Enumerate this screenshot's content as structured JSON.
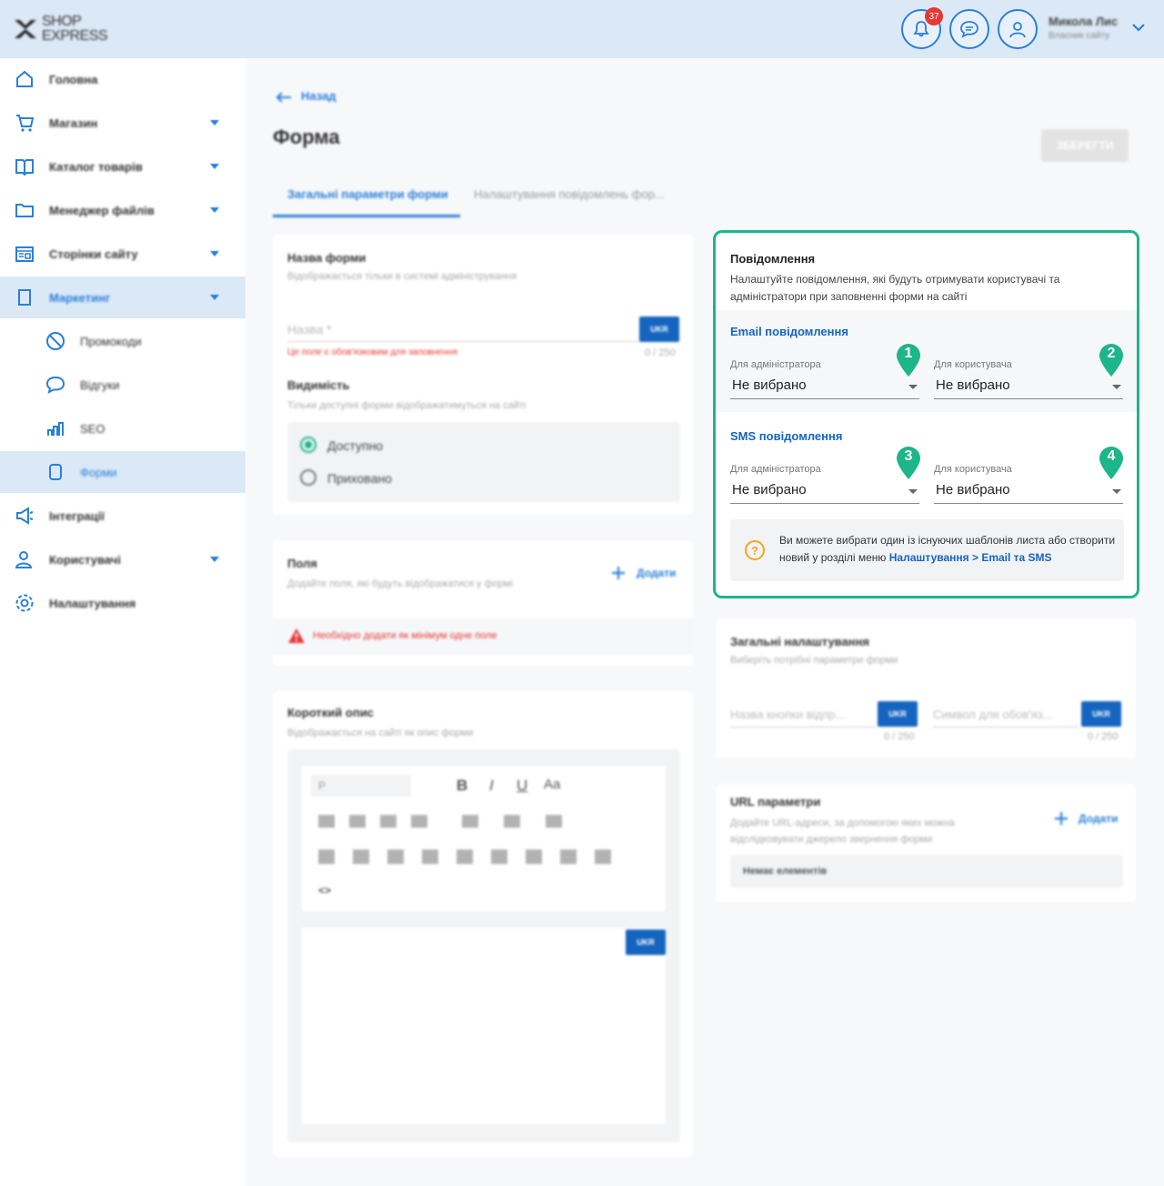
{
  "header": {
    "logo_line1": "SHOP",
    "logo_line2": "EXPRESS",
    "notifications_count": "37",
    "user_name": "Микола Лис",
    "user_role": "Власник сайту"
  },
  "sidebar": {
    "items": [
      {
        "label": "Головна",
        "icon": "home-icon"
      },
      {
        "label": "Магазин",
        "icon": "cart-icon"
      },
      {
        "label": "Каталог товарів",
        "icon": "catalog-icon"
      },
      {
        "label": "Менеджер файлів",
        "icon": "folder-icon"
      },
      {
        "label": "Сторінки сайту",
        "icon": "pages-icon"
      },
      {
        "label": "Маркетинг",
        "icon": "marketing-icon"
      },
      {
        "label": "Промокоди",
        "icon": "promo-icon"
      },
      {
        "label": "Відгуки",
        "icon": "reviews-icon"
      },
      {
        "label": "SEO",
        "icon": "seo-icon"
      },
      {
        "label": "Форми",
        "icon": "forms-icon"
      },
      {
        "label": "Інтеграції",
        "icon": "megaphone-icon"
      },
      {
        "label": "Користувачі",
        "icon": "users-icon"
      },
      {
        "label": "Налаштування",
        "icon": "settings-icon"
      }
    ]
  },
  "page": {
    "back": "Назад",
    "title": "Форма",
    "save": "ЗБЕРЕГТИ",
    "tabs": [
      "Загальні параметри форми",
      "Налаштування повідомлень фор..."
    ]
  },
  "name_card": {
    "title": "Назва форми",
    "sub": "Відображається тільки в системі адміністрування",
    "placeholder": "Назва *",
    "lang": "UKR",
    "error": "Це поле є обов'язковим для заповнення",
    "counter": "0 / 250",
    "visibility_title": "Видимість",
    "visibility_sub": "Тільки доступні форми відображатимуться на сайті",
    "opt_available": "Доступно",
    "opt_hidden": "Приховано"
  },
  "fields_card": {
    "title": "Поля",
    "sub": "Додайте поля, які будуть відображатися у формі",
    "add": "Додати",
    "warning": "Необхідно додати як мінімум одне поле"
  },
  "desc_card": {
    "title": "Короткий опис",
    "sub": "Відображається на сайті як опис форми",
    "format": "P",
    "lang": "UKR"
  },
  "notifications": {
    "title": "Повідомлення",
    "desc": "Налаштуйте повідомлення, які будуть отримувати користувачі та адміністратори при заповненні форми на сайті",
    "email_title": "Email повідомлення",
    "sms_title": "SMS повідомлення",
    "admin_label": "Для адміністратора",
    "user_label": "Для користувача",
    "not_selected": "Не вибрано",
    "markers": [
      "1",
      "2",
      "3",
      "4"
    ],
    "info_text": "Ви можете вибрати один із існуючих шаблонів листа або створити новий у розділі меню ",
    "info_link": "Налаштування > Email та SMS"
  },
  "general_card": {
    "title": "Загальні налаштування",
    "sub": "Виберіть потрібні параметри форми",
    "btn_name": "Назва кнопки відпр...",
    "symbol": "Символ для обов'яз...",
    "lang": "UKR",
    "counter": "0 / 250"
  },
  "url_card": {
    "title": "URL параметри",
    "sub": "Додайте URL-адреси, за допомогою яких можна відслідковувати джерело звернення форми",
    "add": "Додати",
    "empty": "Немає елементів"
  },
  "colors": {
    "accent": "#2b7fd8",
    "highlight": "#1db58a",
    "marker": "#1db58a",
    "error": "#e53935"
  }
}
